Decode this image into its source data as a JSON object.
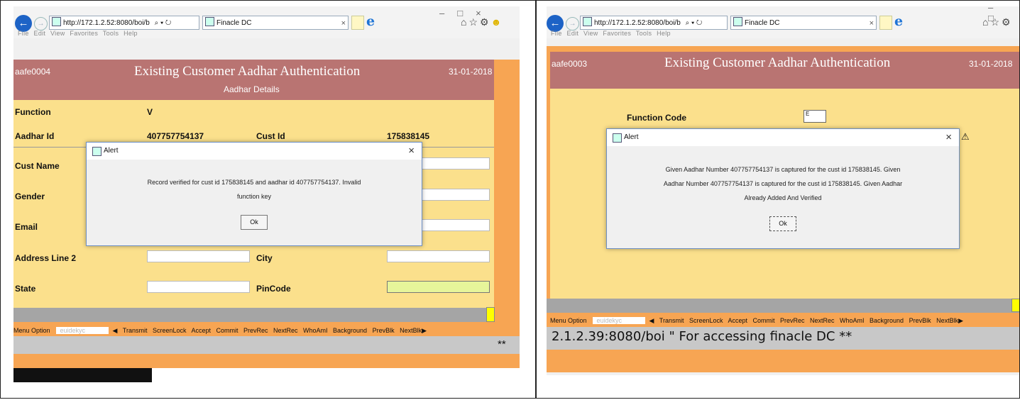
{
  "left": {
    "browser": {
      "url": "http://172.1.2.52:8080/boi/b",
      "url_controls": "⌕ ▾ ↻",
      "tab_title": "Finacle DC",
      "menu": [
        "File",
        "Edit",
        "View",
        "Favorites",
        "Tools",
        "Help"
      ]
    },
    "app": {
      "code": "aafe0004",
      "title": "Existing Customer Aadhar Authentication",
      "date": "31-01-2018",
      "subtitle": "Aadhar Details",
      "fields": {
        "function_label": "Function",
        "function_value": "V",
        "aadhar_label": "Aadhar Id",
        "aadhar_value": "407757754137",
        "custid_label": "Cust Id",
        "custid_value": "175838145",
        "custname_label": "Cust Name",
        "gender_label": "Gender",
        "email_label": "Email",
        "address2_label": "Address Line 2",
        "city_label": "City",
        "state_label": "State",
        "pincode_label": "PinCode"
      },
      "menu_option_label": "Menu Option",
      "menu_option_value": "euidekyc",
      "menu_items": "◀ Transmit ScreenLock Accept Commit PrevRec NextRec WhoAmI Background PrevBlk NextBlk▶",
      "stars": "**"
    },
    "alert": {
      "title": "Alert",
      "line1": "Record verified for cust id 175838145 and aadhar id 407757754137. Invalid",
      "line2": "function key",
      "ok": "Ok"
    }
  },
  "right": {
    "browser": {
      "url": "http://172.1.2.52:8080/boi/b",
      "url_controls": "⌕ ▾ ↻",
      "tab_title": "Finacle DC",
      "menu": [
        "File",
        "Edit",
        "View",
        "Favorites",
        "Tools",
        "Help"
      ]
    },
    "app": {
      "code": "aafe0003",
      "title": "Existing Customer Aadhar Authentication",
      "date": "31-01-2018",
      "function_code_label": "Function Code",
      "function_code_value": "E",
      "menu_option_label": "Menu Option",
      "menu_option_value": "euidekyc",
      "menu_items": "◀ Transmit ScreenLock Accept Commit PrevRec NextRec WhoAmI Background PrevBlk NextBlk▶",
      "footer_text": "2.1.2.39:8080/boi \" For accessing finacle DC **"
    },
    "alert": {
      "title": "Alert",
      "line1": "Given Aadhar Number 407757754137 is captured for the cust id 175838145. Given",
      "line2": "Aadhar Number 407757754137 is captured for the cust id 175838145. Given Aadhar",
      "line3": "Already Added And Verified",
      "ok": "Ok"
    }
  },
  "colors": {
    "header": "#b97472",
    "form_bg": "#fbe08c",
    "outer_bg": "#f7a553",
    "highlight_yellow": "#ffff00",
    "pincode_green": "#e6f59a"
  }
}
